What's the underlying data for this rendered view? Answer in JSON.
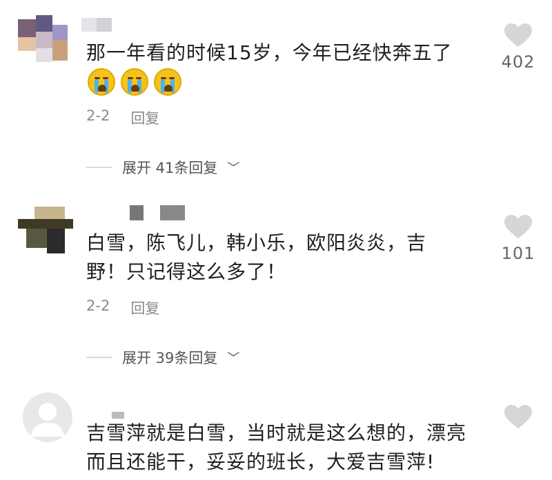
{
  "comments": [
    {
      "text": "那一年看的时候15岁，今年已经快奔五了",
      "emojis": [
        "crying-emoji",
        "crying-emoji",
        "crying-emoji"
      ],
      "date": "2-2",
      "reply_label": "回复",
      "expand_label": "展开 41条回复",
      "likes": "402"
    },
    {
      "text": "白雪，陈飞儿，韩小乐，欧阳炎炎，吉野！只记得这么多了！",
      "date": "2-2",
      "reply_label": "回复",
      "expand_label": "展开 39条回复",
      "likes": "101"
    },
    {
      "text": "吉雪萍就是白雪，当时就是这么想的，漂亮而且还能干，妥妥的班长，大爱吉雪萍!"
    }
  ],
  "colors": {
    "text": "#1f1f1f",
    "meta": "#8a8a8a",
    "heart": "#d6d6d6"
  }
}
